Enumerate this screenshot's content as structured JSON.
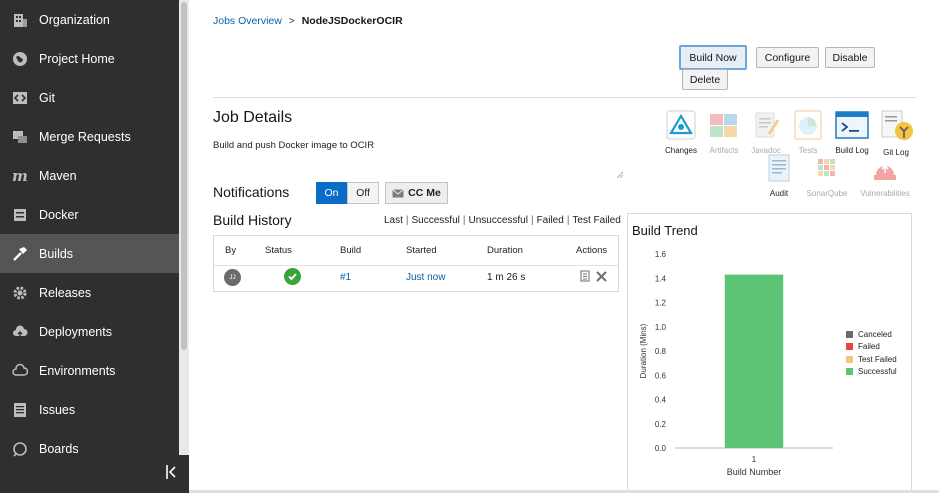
{
  "sidebar": {
    "items": [
      {
        "label": "Organization",
        "icon": "building-icon"
      },
      {
        "label": "Project Home",
        "icon": "globe-icon"
      },
      {
        "label": "Git",
        "icon": "code-box-icon"
      },
      {
        "label": "Merge Requests",
        "icon": "merge-icon"
      },
      {
        "label": "Maven",
        "icon": "maven-icon"
      },
      {
        "label": "Docker",
        "icon": "docker-icon"
      },
      {
        "label": "Builds",
        "icon": "hammer-icon",
        "active": true
      },
      {
        "label": "Releases",
        "icon": "gear-icon"
      },
      {
        "label": "Deployments",
        "icon": "cloud-upload-icon"
      },
      {
        "label": "Environments",
        "icon": "cloud-icon"
      },
      {
        "label": "Issues",
        "icon": "issues-icon"
      },
      {
        "label": "Boards",
        "icon": "boards-icon"
      }
    ]
  },
  "breadcrumb": {
    "parent": "Jobs Overview",
    "separator": ">",
    "current": "NodeJSDockerOCIR"
  },
  "actions": {
    "build_now": "Build Now",
    "configure": "Configure",
    "disable": "Disable",
    "delete": "Delete"
  },
  "job": {
    "title": "Job Details",
    "description": "Build and push Docker image to OCIR"
  },
  "tools": [
    {
      "label": "Changes",
      "icon": "changes-icon",
      "enabled": true
    },
    {
      "label": "Artifacts",
      "icon": "artifacts-icon",
      "enabled": false
    },
    {
      "label": "Javadoc",
      "icon": "javadoc-icon",
      "enabled": false
    },
    {
      "label": "Tests",
      "icon": "tests-icon",
      "enabled": false
    },
    {
      "label": "Build Log",
      "icon": "build-log-icon",
      "enabled": true
    },
    {
      "label": "Git Log",
      "icon": "git-log-icon",
      "enabled": true
    },
    {
      "label": "Audit",
      "icon": "audit-icon",
      "enabled": true
    },
    {
      "label": "SonarQube",
      "icon": "sonarqube-icon",
      "enabled": false
    },
    {
      "label": "Vulnerabilities",
      "icon": "vulnerabilities-icon",
      "enabled": false
    }
  ],
  "notifications": {
    "title": "Notifications",
    "on": "On",
    "off": "Off",
    "cc": "CC Me",
    "state": "On"
  },
  "history": {
    "title": "Build History",
    "filters": [
      "Last",
      "Successful",
      "Unsuccessful",
      "Failed",
      "Test Failed"
    ],
    "columns": [
      "By",
      "Status",
      "Build",
      "Started",
      "Duration",
      "Actions"
    ],
    "rows": [
      {
        "by": "JJ",
        "status": "success",
        "build": "#1",
        "started": "Just now",
        "duration": "1 m 26 s"
      }
    ]
  },
  "trend": {
    "title": "Build Trend",
    "legend": [
      {
        "name": "Canceled",
        "color": "#6b6b6b"
      },
      {
        "name": "Failed",
        "color": "#e8453c"
      },
      {
        "name": "Test Failed",
        "color": "#f0c87a"
      },
      {
        "name": "Successful",
        "color": "#5cc475"
      }
    ]
  },
  "chart_data": {
    "type": "bar",
    "title": "Build Trend",
    "xlabel": "Build Number",
    "ylabel": "Duration (Mins)",
    "categories": [
      "1"
    ],
    "series": [
      {
        "name": "Successful",
        "values": [
          1.43
        ]
      }
    ],
    "ylim": [
      0,
      1.6
    ],
    "yticks": [
      "0.0",
      "0.2",
      "0.4",
      "0.6",
      "0.8",
      "1.0",
      "1.2",
      "1.4",
      "1.6"
    ],
    "grid": false,
    "legend": "right",
    "bar_color": "#5cc475"
  }
}
